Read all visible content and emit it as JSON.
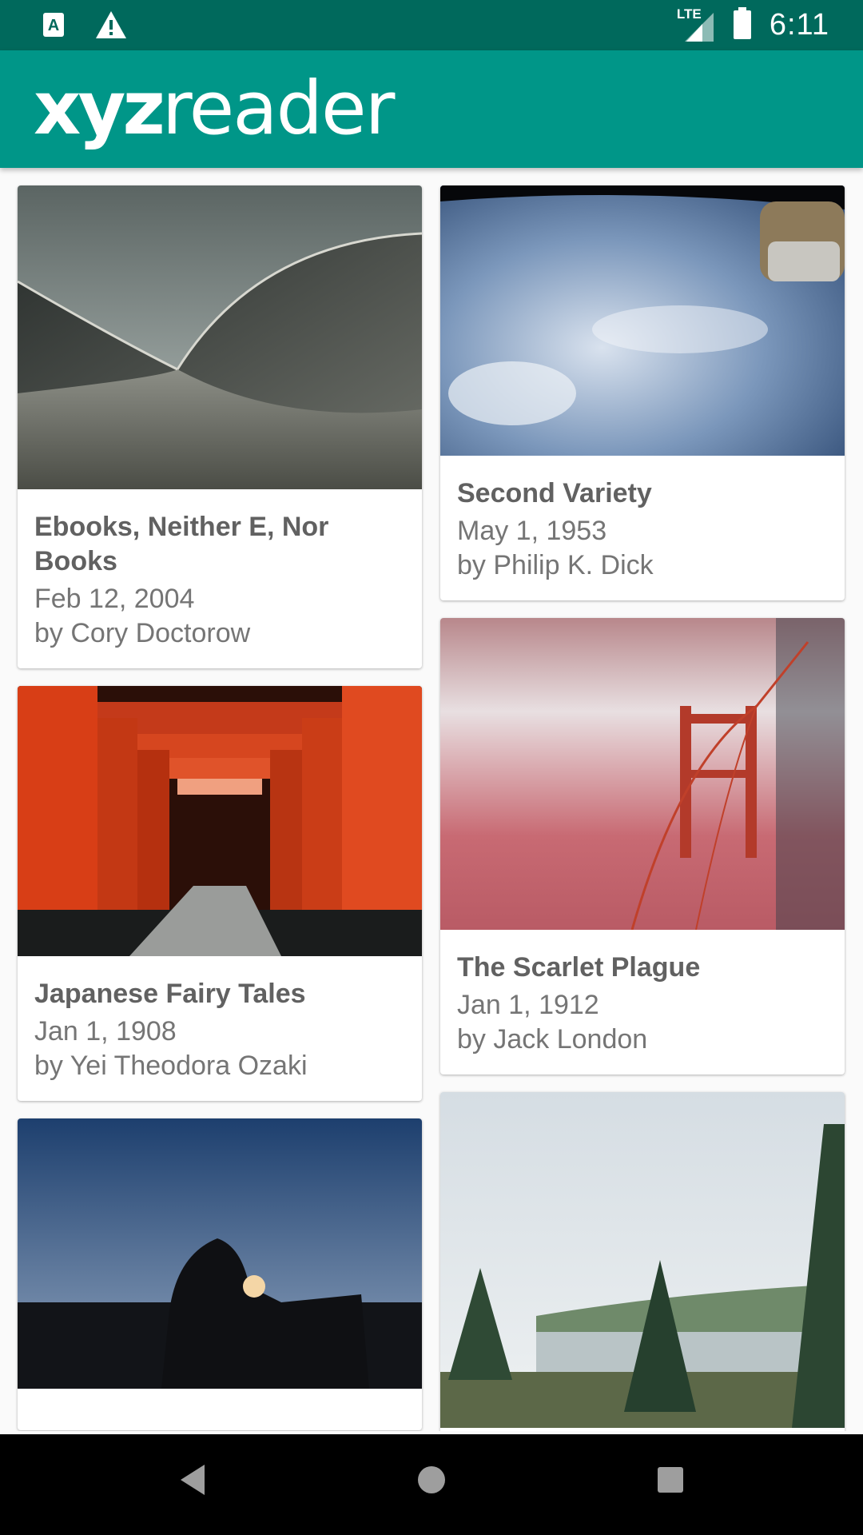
{
  "status_bar": {
    "time": "6:11",
    "network": "LTE",
    "icons": [
      "sim-a-icon",
      "warning-icon",
      "signal-icon",
      "battery-icon"
    ]
  },
  "app_bar": {
    "logo_bold": "xyz",
    "logo_light": "reader",
    "background": "#009688",
    "status_background": "#00695c"
  },
  "articles": [
    {
      "title": "Ebooks, Neither E, Nor Books",
      "date": "Feb 12, 2004",
      "author": "by Cory Doctorow",
      "image": "opera-house-roof"
    },
    {
      "title": "Second Variety",
      "date": "May 1, 1953",
      "author": "by Philip K. Dick",
      "image": "earth-from-orbit"
    },
    {
      "title": "Japanese Fairy Tales",
      "date": "Jan 1, 1908",
      "author": "by Yei Theodora Ozaki",
      "image": "torii-gates-path"
    },
    {
      "title": "The Scarlet Plague",
      "date": "Jan 1, 1912",
      "author": "by Jack London",
      "image": "golden-gate-fog"
    },
    {
      "title": "",
      "date": "",
      "author": "",
      "image": "rider-with-lantern"
    },
    {
      "title": "",
      "date": "",
      "author": "",
      "image": "lake-with-pines"
    }
  ],
  "nav_bar": {
    "buttons": [
      "back-icon",
      "home-icon",
      "recents-icon"
    ]
  }
}
